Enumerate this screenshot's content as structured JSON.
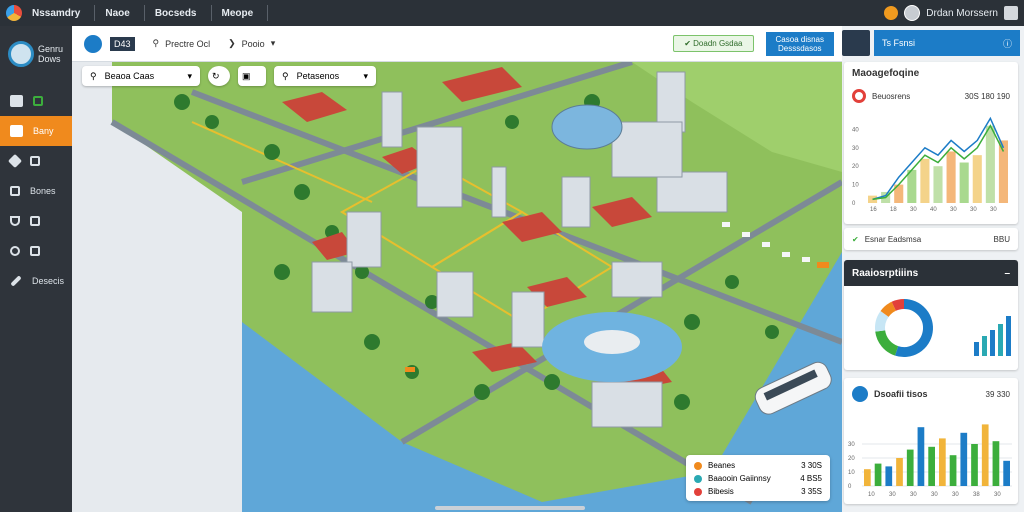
{
  "top_menu": {
    "app_name": "Nssamdry",
    "items": [
      "Naoe",
      "Bocseds",
      "Meope"
    ],
    "user_name": "Drdan Morssern"
  },
  "sidebar": {
    "brand_line1": "Genru",
    "brand_line2": "Dows",
    "items": [
      {
        "label": "",
        "icon": "dashboard-icon"
      },
      {
        "label": "Bany",
        "icon": "home-icon",
        "active": true
      },
      {
        "label": "",
        "icon": "layers-icon"
      },
      {
        "label": "Bones",
        "icon": "grid-icon"
      },
      {
        "label": "",
        "icon": "shield-icon"
      },
      {
        "label": "",
        "icon": "search-icon"
      },
      {
        "label": "Desecis",
        "icon": "pen-icon"
      }
    ]
  },
  "toolbar": {
    "badge": "D43",
    "place_label": "Prectre Ocl",
    "filter_label": "Pooio",
    "green_label": "Doadn Gsdaa",
    "blue_btn_line1": "Casoa disnas",
    "blue_btn_line2": "Desssdasos"
  },
  "map_controls": {
    "search1": "Beaoa Caas",
    "search2": "Petasenos"
  },
  "legend": [
    {
      "label": "Beanes",
      "value": "3 30S",
      "color": "#f08a1d"
    },
    {
      "label": "Baaooin Gaiinnsy",
      "value": "4 BS5",
      "color": "#2aa9b3"
    },
    {
      "label": "Bibesis",
      "value": "3 35S",
      "color": "#e2403a"
    }
  ],
  "right_panel": {
    "header": "Ts Fsnsi",
    "card1_title": "Maoagefoqine",
    "card1_legend": "Beuosrens",
    "card1_legend_values": "30S 180 190",
    "card1_footer_left": "Esnar Eadsmsa",
    "card1_footer_right": "BBU",
    "card2_title": "Raaiosrptiiins",
    "card3_title": "Dsoafii tisos",
    "card3_values": "39 330"
  },
  "chart_data": [
    {
      "type": "line",
      "categories": [
        "16",
        "18",
        "30",
        "40",
        "30",
        "30",
        "30"
      ],
      "ylim": [
        0,
        50
      ],
      "series": [
        {
          "values": [
            2,
            4,
            14,
            22,
            30,
            26,
            34,
            28,
            34,
            46,
            30
          ]
        },
        {
          "values": [
            2,
            3,
            10,
            18,
            26,
            22,
            30,
            24,
            30,
            42,
            28
          ]
        }
      ],
      "bars": [
        4,
        6,
        10,
        18,
        24,
        20,
        28,
        22,
        26,
        42,
        34
      ]
    },
    {
      "type": "pie",
      "values": [
        55,
        18,
        12,
        8,
        7
      ],
      "colors": [
        "#1c7cc7",
        "#3cae3c",
        "#c7e6f5",
        "#f08a1d",
        "#e2403a"
      ],
      "bar_values": [
        14,
        20,
        26,
        32,
        40
      ]
    },
    {
      "type": "bar",
      "categories": [
        "10",
        "30",
        "30",
        "30",
        "30",
        "38",
        "30"
      ],
      "values": [
        12,
        16,
        14,
        20,
        26,
        42,
        28,
        34,
        22,
        38,
        30,
        44,
        32,
        18
      ],
      "colors": [
        "#f1b43a",
        "#3cae3c",
        "#1c7cc7",
        "#f1b43a",
        "#3cae3c",
        "#1c7cc7",
        "#3cae3c",
        "#f1b43a",
        "#3cae3c",
        "#1c7cc7",
        "#3cae3c",
        "#f1b43a",
        "#3cae3c",
        "#1c7cc7"
      ]
    }
  ]
}
